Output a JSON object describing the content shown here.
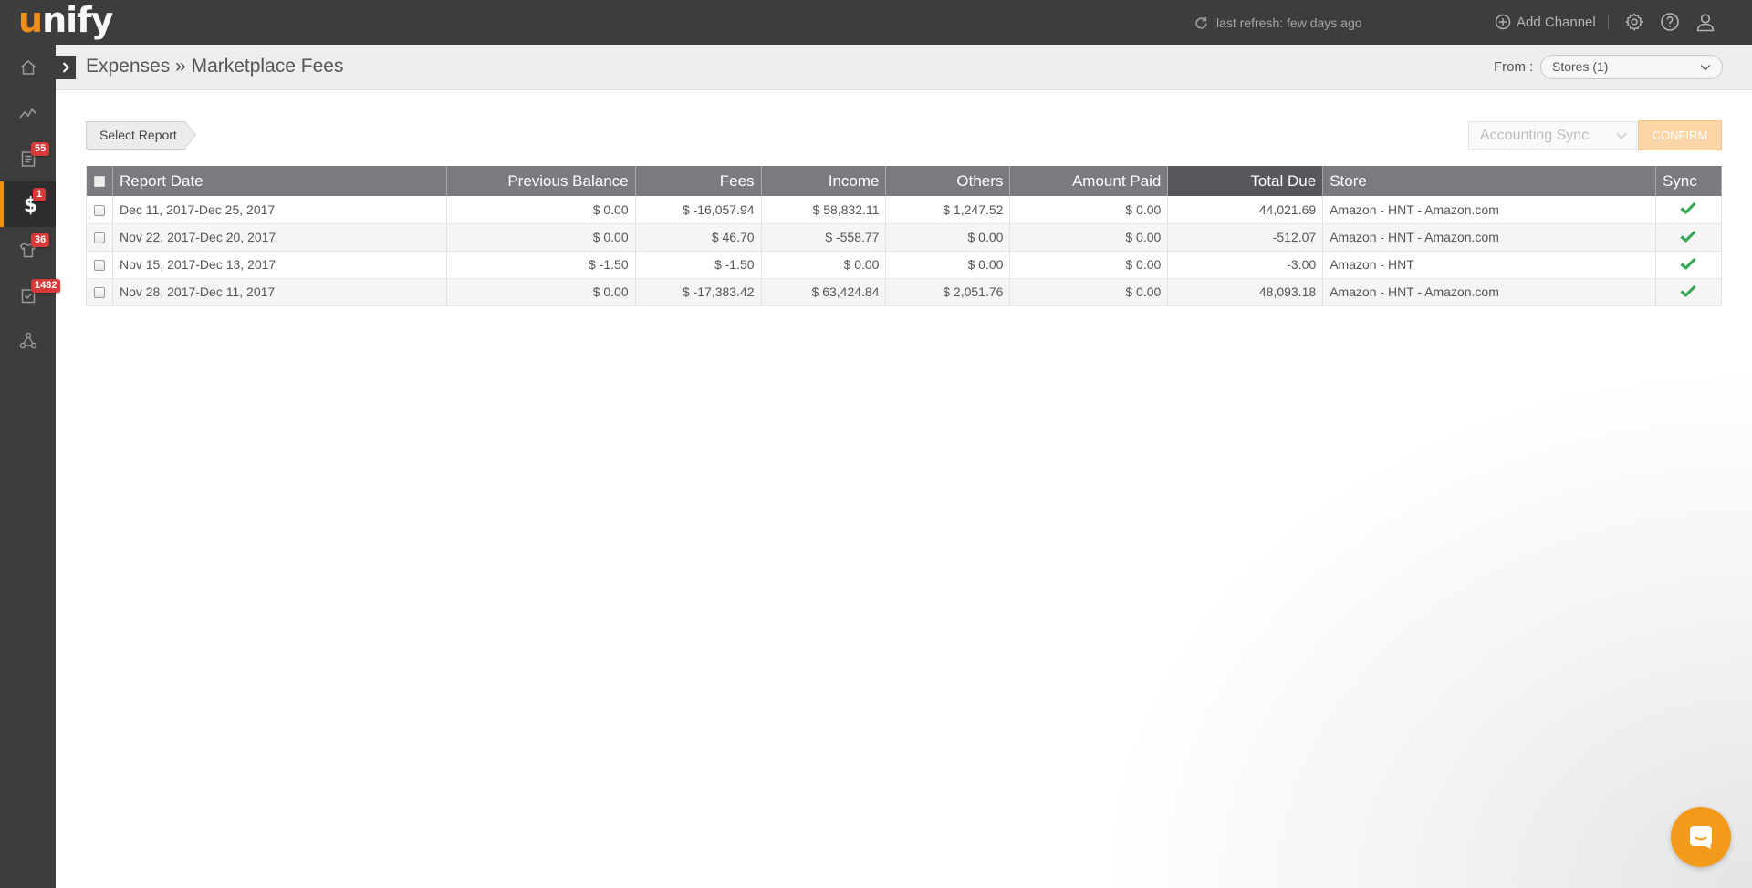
{
  "app": {
    "logo_prefix": "u",
    "logo_rest": "nify",
    "refresh_text": "last refresh: few days ago",
    "add_channel": "Add Channel"
  },
  "sidebar": {
    "items": [
      {
        "icon": "home-icon"
      },
      {
        "icon": "analytics-icon"
      },
      {
        "icon": "orders-icon",
        "badge": "55"
      },
      {
        "icon": "dollar-icon",
        "badge": "1",
        "active": true
      },
      {
        "icon": "shirt-icon",
        "badge": "36"
      },
      {
        "icon": "tasks-icon",
        "badge": "1482"
      },
      {
        "icon": "network-icon"
      }
    ]
  },
  "header": {
    "title": "Expenses » Marketplace Fees",
    "from_label": "From :",
    "store_selected": "Stores (1)"
  },
  "controls": {
    "select_report": "Select Report",
    "accounting_sync": "Accounting Sync",
    "confirm": "CONFIRM"
  },
  "table": {
    "columns": [
      "Report Date",
      "Previous Balance",
      "Fees",
      "Income",
      "Others",
      "Amount Paid",
      "Total Due",
      "Store",
      "Sync"
    ],
    "rows": [
      {
        "date": "Dec 11, 2017-Dec 25, 2017",
        "prev": "$ 0.00",
        "fees": "$ -16,057.94",
        "income": "$ 58,832.11",
        "others": "$ 1,247.52",
        "paid": "$ 0.00",
        "due": "44,021.69",
        "store": "Amazon - HNT - Amazon.com",
        "sync": true
      },
      {
        "date": "Nov 22, 2017-Dec 20, 2017",
        "prev": "$ 0.00",
        "fees": "$ 46.70",
        "income": "$ -558.77",
        "others": "$ 0.00",
        "paid": "$ 0.00",
        "due": "-512.07",
        "store": "Amazon - HNT - Amazon.com",
        "sync": true
      },
      {
        "date": "Nov 15, 2017-Dec 13, 2017",
        "prev": "$ -1.50",
        "fees": "$ -1.50",
        "income": "$ 0.00",
        "others": "$ 0.00",
        "paid": "$ 0.00",
        "due": "-3.00",
        "store": "Amazon - HNT",
        "sync": true
      },
      {
        "date": "Nov 28, 2017-Dec 11, 2017",
        "prev": "$ 0.00",
        "fees": "$ -17,383.42",
        "income": "$ 63,424.84",
        "others": "$ 2,051.76",
        "paid": "$ 0.00",
        "due": "48,093.18",
        "store": "Amazon - HNT - Amazon.com",
        "sync": true
      }
    ]
  },
  "colors": {
    "accent": "#f0901a",
    "topbar": "#3d3d3d",
    "header_row": "#7a7a80",
    "sync_check": "#3aa858"
  }
}
